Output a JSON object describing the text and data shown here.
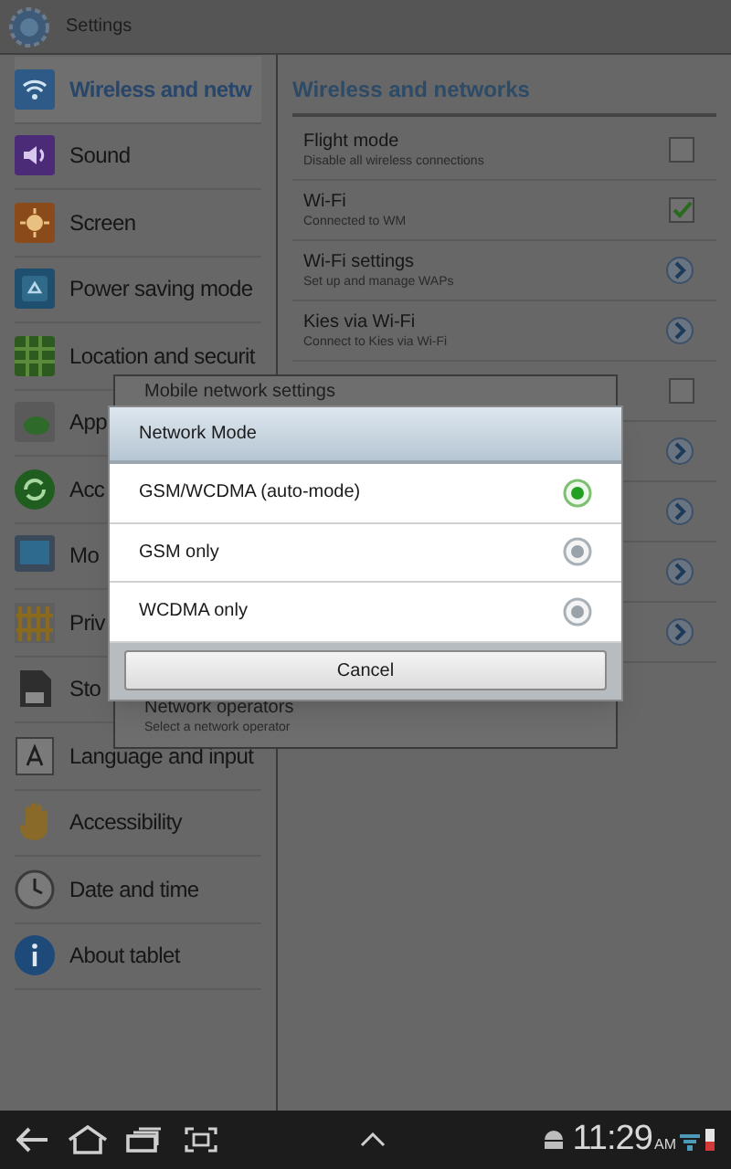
{
  "header": {
    "title": "Settings"
  },
  "sidebar": {
    "items": [
      {
        "label": "Wireless and netw",
        "selected": true
      },
      {
        "label": "Sound",
        "selected": false
      },
      {
        "label": "Screen",
        "selected": false
      },
      {
        "label": "Power saving mode",
        "selected": false
      },
      {
        "label": "Location and securit",
        "selected": false
      },
      {
        "label": "App",
        "selected": false
      },
      {
        "label": "Acc",
        "selected": false
      },
      {
        "label": "Mo",
        "selected": false
      },
      {
        "label": "Priv",
        "selected": false
      },
      {
        "label": "Sto",
        "selected": false
      },
      {
        "label": "Language and input",
        "selected": false
      },
      {
        "label": "Accessibility",
        "selected": false
      },
      {
        "label": "Date and time",
        "selected": false
      },
      {
        "label": "About tablet",
        "selected": false
      }
    ]
  },
  "panel": {
    "title": "Wireless and networks",
    "rows": [
      {
        "kind": "checkbox",
        "title": "Flight mode",
        "subtitle": "Disable all wireless connections",
        "checked": false
      },
      {
        "kind": "checkbox",
        "title": "Wi-Fi",
        "subtitle": "Connected to WM",
        "checked": true
      },
      {
        "kind": "arrow",
        "title": "Wi-Fi settings",
        "subtitle": "Set up and manage WAPs"
      },
      {
        "kind": "arrow",
        "title": "Kies via Wi-Fi",
        "subtitle": "Connect to Kies via Wi-Fi"
      },
      {
        "kind": "checkbox",
        "checked": false
      },
      {
        "kind": "arrow"
      },
      {
        "kind": "arrow"
      },
      {
        "kind": "arrow"
      },
      {
        "kind": "arrow"
      }
    ]
  },
  "back_dialog": {
    "title": "Mobile network settings",
    "items": [
      {
        "title": "Network operators",
        "subtitle": "Select a network operator"
      }
    ]
  },
  "dialog": {
    "title": "Network Mode",
    "options": [
      {
        "label": "GSM/WCDMA (auto-mode)",
        "selected": true
      },
      {
        "label": "GSM only",
        "selected": false
      },
      {
        "label": "WCDMA only",
        "selected": false
      }
    ],
    "button": "Cancel"
  },
  "navbar": {
    "time": "11:29",
    "period": "AM"
  }
}
